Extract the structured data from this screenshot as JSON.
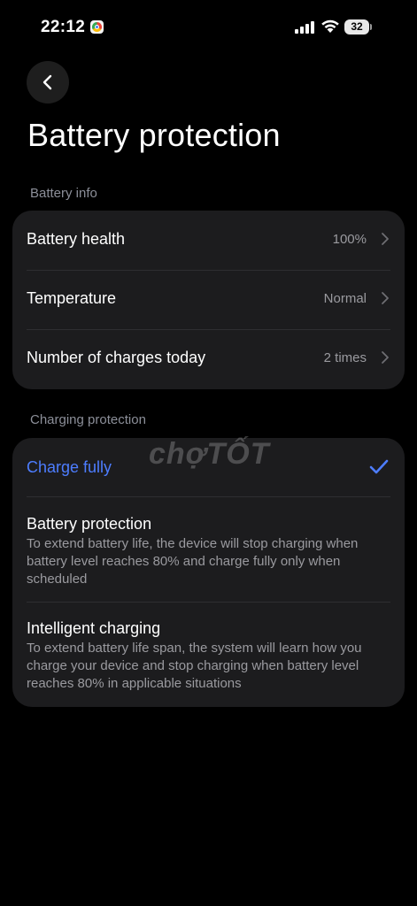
{
  "status_bar": {
    "time": "22:12",
    "battery_level": "32"
  },
  "page": {
    "title": "Battery protection"
  },
  "battery_info": {
    "section_label": "Battery info",
    "rows": [
      {
        "label": "Battery health",
        "value": "100%"
      },
      {
        "label": "Temperature",
        "value": "Normal"
      },
      {
        "label": "Number of charges today",
        "value": "2 times"
      }
    ]
  },
  "charging_protection": {
    "section_label": "Charging protection",
    "options": [
      {
        "title": "Charge fully",
        "description": "",
        "selected": true
      },
      {
        "title": "Battery protection",
        "description": "To extend battery life, the device will stop charging when battery level reaches 80% and charge fully only when scheduled",
        "selected": false
      },
      {
        "title": "Intelligent charging",
        "description": "To extend battery life span, the system will learn how you charge your device and stop charging when battery level reaches 80% in applicable situations",
        "selected": false
      }
    ]
  },
  "watermark": "chợTỐT",
  "colors": {
    "background": "#000000",
    "card": "#1c1c1e",
    "accent": "#4d7dff",
    "secondary_text": "#9a9a9f"
  },
  "icons": [
    "chrome-icon",
    "signal-icon",
    "wifi-icon",
    "battery-icon",
    "back-arrow-icon",
    "chevron-right-icon",
    "checkmark-icon"
  ]
}
